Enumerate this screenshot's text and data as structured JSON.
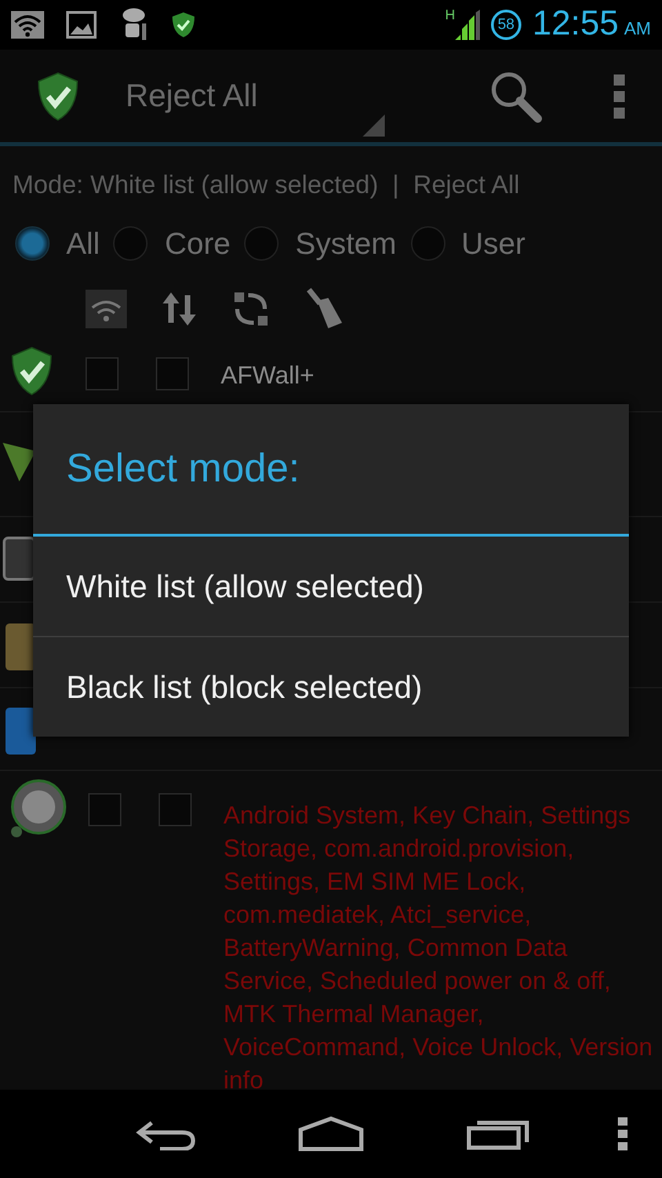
{
  "status_bar": {
    "network": "H",
    "battery": "58",
    "time": "12:55",
    "am_pm": "AM"
  },
  "action_bar": {
    "title": "Reject All"
  },
  "mode_line": "Mode: White list (allow selected)  |  Reject All",
  "filters": [
    {
      "label": "All",
      "selected": true
    },
    {
      "label": "Core",
      "selected": false
    },
    {
      "label": "System",
      "selected": false
    },
    {
      "label": "User",
      "selected": false
    }
  ],
  "apps": [
    {
      "kind": "shield",
      "name": "AFWall+",
      "wifi_checked": false,
      "data_checked": false,
      "color": "#8c8c8c"
    },
    {
      "kind": "gear",
      "name": "Android System, Key Chain, Settings Storage, com.android.provision, Settings, EM SIM ME Lock, com.mediatek, Atci_service, BatteryWarning, Common Data Service, Scheduled power on & off, MTK Thermal Manager, VoiceCommand, Voice Unlock, Version info",
      "wifi_checked": false,
      "data_checked": false,
      "color": "#7a0808"
    }
  ],
  "dialog": {
    "title": "Select mode:",
    "options": [
      {
        "label": "White list (allow selected)"
      },
      {
        "label": "Black list (block selected)"
      }
    ]
  }
}
